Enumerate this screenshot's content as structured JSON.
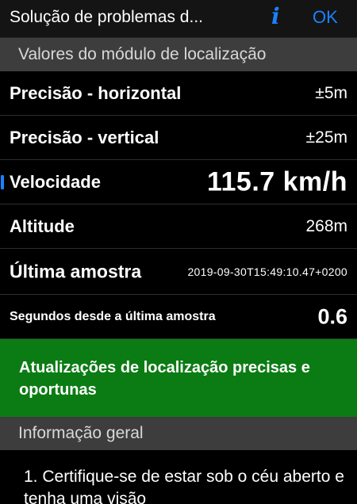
{
  "nav": {
    "title": "Solução de problemas d...",
    "info_glyph": "i",
    "ok_label": "OK",
    "accent_color": "#1a82ff"
  },
  "sections": {
    "location_values": "Valores do módulo de localização",
    "general_info": "Informação geral"
  },
  "rows": [
    {
      "label": "Precisão - horizontal",
      "value": "±5m"
    },
    {
      "label": "Precisão - vertical",
      "value": "±25m"
    },
    {
      "label": "Velocidade",
      "value": "115.7 km/h"
    },
    {
      "label": "Altitude",
      "value": "268m"
    },
    {
      "label": "Última amostra",
      "value": "2019-09-30T15:49:10.47+0200"
    },
    {
      "label": "Segundos desde a última amostra",
      "value": "0.6"
    }
  ],
  "status": {
    "text": "Atualizações de localização precisas e oportunas",
    "color": "#0b7c14"
  },
  "general_info": {
    "text": "1. Certifique-se de estar sob o céu aberto e tenha uma visão"
  }
}
